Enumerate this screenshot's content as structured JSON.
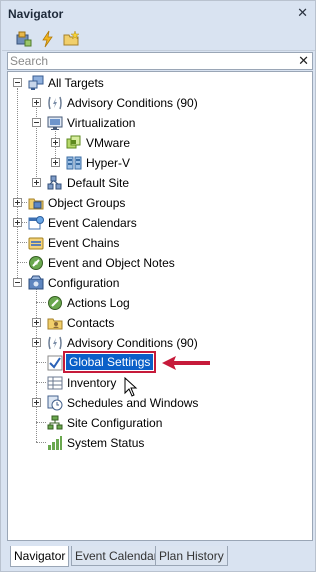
{
  "panel": {
    "title": "Navigator"
  },
  "toolbar": {
    "buttons": [
      "new-object-icon",
      "lightning-icon",
      "new-folder-icon"
    ]
  },
  "search": {
    "placeholder": "Search",
    "value": ""
  },
  "tree": {
    "all_targets": "All Targets",
    "advisory_conditions": "Advisory Conditions (90)",
    "virtualization": "Virtualization",
    "vmware": "VMware",
    "hyperv": "Hyper-V",
    "default_site": "Default Site",
    "object_groups": "Object Groups",
    "event_calendars": "Event Calendars",
    "event_chains": "Event Chains",
    "event_notes": "Event and Object Notes",
    "configuration": "Configuration",
    "actions_log": "Actions Log",
    "contacts": "Contacts",
    "config_advisory": "Advisory Conditions (90)",
    "global_settings": "Global Settings",
    "inventory": "Inventory",
    "schedules": "Schedules and Windows",
    "site_configuration": "Site Configuration",
    "system_status": "System Status"
  },
  "tabs": [
    "Navigator",
    "Event Calendar",
    "Plan History"
  ],
  "colors": {
    "selection": "#0a5fc8",
    "highlight_border": "#c61a3a",
    "arrow": "#c61a3a"
  }
}
